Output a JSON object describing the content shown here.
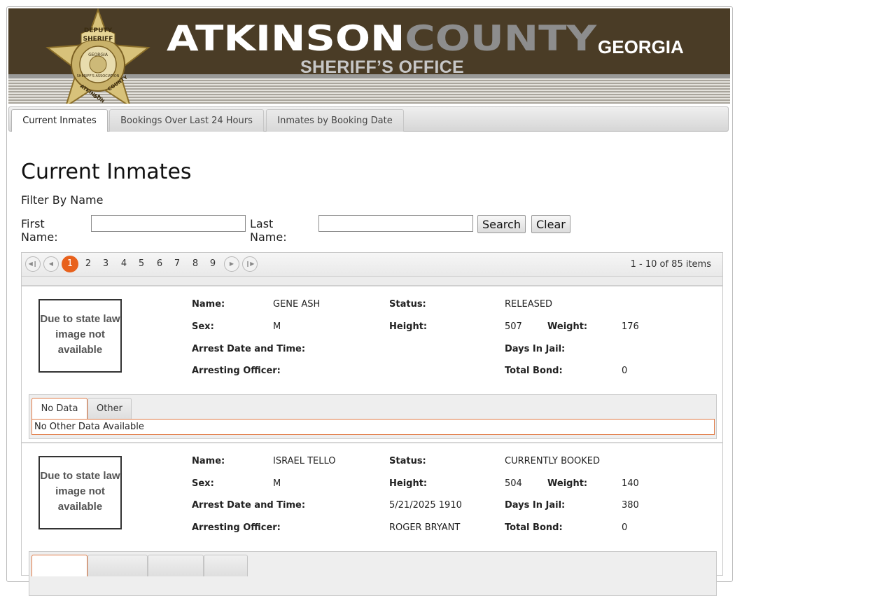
{
  "header": {
    "title_part1": "ATKINSON",
    "title_part2": "COUNTY",
    "state": "GEORGIA",
    "subtitle": "SHERIFF’S OFFICE",
    "badge_lines": [
      "DEPUTY",
      "SHERIFF",
      "GEORGIA",
      "SHERIFF'S ASSOCIATION",
      "ATKINSON",
      "GA.",
      "COUNTY"
    ]
  },
  "nav": {
    "tabs": [
      {
        "label": "Current Inmates",
        "active": true
      },
      {
        "label": "Bookings Over Last 24 Hours",
        "active": false
      },
      {
        "label": "Inmates by Booking Date",
        "active": false
      }
    ]
  },
  "page": {
    "title": "Current Inmates",
    "filter_label": "Filter By Name",
    "first_name_label": "First Name:",
    "last_name_label": "Last Name:",
    "first_name_value": "",
    "last_name_value": "",
    "search_label": "Search",
    "clear_label": "Clear"
  },
  "pager": {
    "pages": [
      "1",
      "2",
      "3",
      "4",
      "5",
      "6",
      "7",
      "8",
      "9"
    ],
    "current_page": "1",
    "info": "1 - 10 of 85 items",
    "icons": {
      "first": "first-page-icon",
      "prev": "prev-page-icon",
      "next": "next-page-icon",
      "last": "last-page-icon"
    }
  },
  "labels": {
    "name": "Name:",
    "sex": "Sex:",
    "arrest": "Arrest Date and Time:",
    "officer": "Arresting Officer:",
    "status": "Status:",
    "height": "Height:",
    "weight": "Weight:",
    "days": "Days In Jail:",
    "bond": "Total Bond:",
    "photo_text": "Due to state law image not available"
  },
  "inmates": [
    {
      "name": "GENE ASH",
      "sex": "M",
      "arrest": "",
      "officer": "",
      "status": "RELEASED",
      "height": "507",
      "weight": "176",
      "days": "",
      "bond": "0",
      "tabs": [
        "No Data",
        "Other"
      ],
      "panel_text": "No Other Data Available"
    },
    {
      "name": "ISRAEL TELLO",
      "sex": "M",
      "arrest": "5/21/2025 1910",
      "officer": "ROGER BRYANT",
      "status": "CURRENTLY BOOKED",
      "height": "504",
      "weight": "140",
      "days": "380",
      "bond": "0"
    }
  ],
  "colors": {
    "banner": "#4a3c26",
    "accent": "#e8611c",
    "county_text": "#8d8d8d"
  }
}
